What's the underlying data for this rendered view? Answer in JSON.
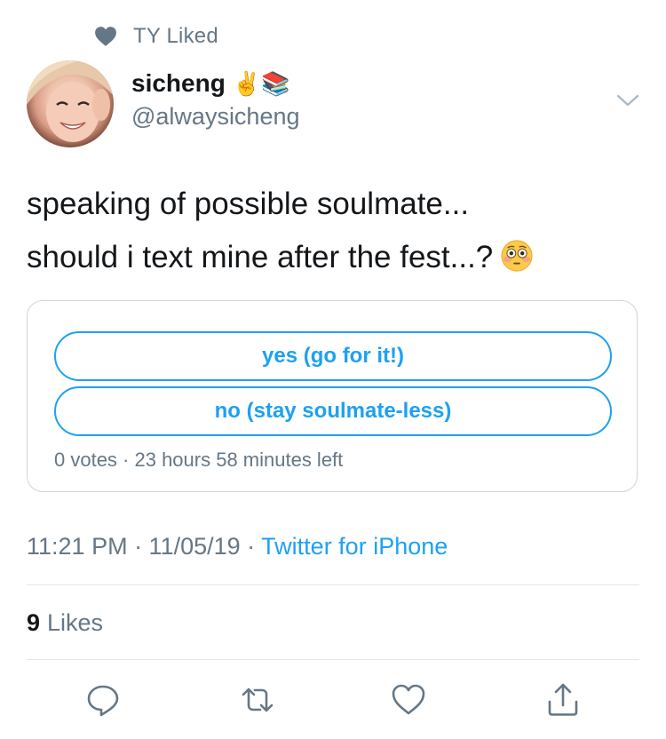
{
  "social_context": {
    "text": "TY Liked",
    "icon": "heart-icon"
  },
  "author": {
    "display_name": "sicheng",
    "emojis": "✌️📚",
    "handle": "@alwaysicheng"
  },
  "tweet": {
    "line1": "speaking of possible soulmate...",
    "line2": "should i text mine after the fest...?",
    "emoji": "flushed-face-emoji"
  },
  "poll": {
    "options": [
      {
        "label": "yes (go for it!)"
      },
      {
        "label": "no (stay soulmate-less)"
      }
    ],
    "meta": "0 votes · 23 hours 58 minutes left"
  },
  "timestamp": {
    "time": "11:21 PM · 11/05/19 · ",
    "source": "Twitter for iPhone"
  },
  "likes": {
    "count": "9",
    "label": "Likes"
  },
  "actions": [
    "reply-icon",
    "retweet-icon",
    "like-icon",
    "share-icon"
  ],
  "colors": {
    "accent": "#1da1f2",
    "muted": "#657786",
    "text": "#14171a",
    "divider": "#e1e8ed"
  }
}
